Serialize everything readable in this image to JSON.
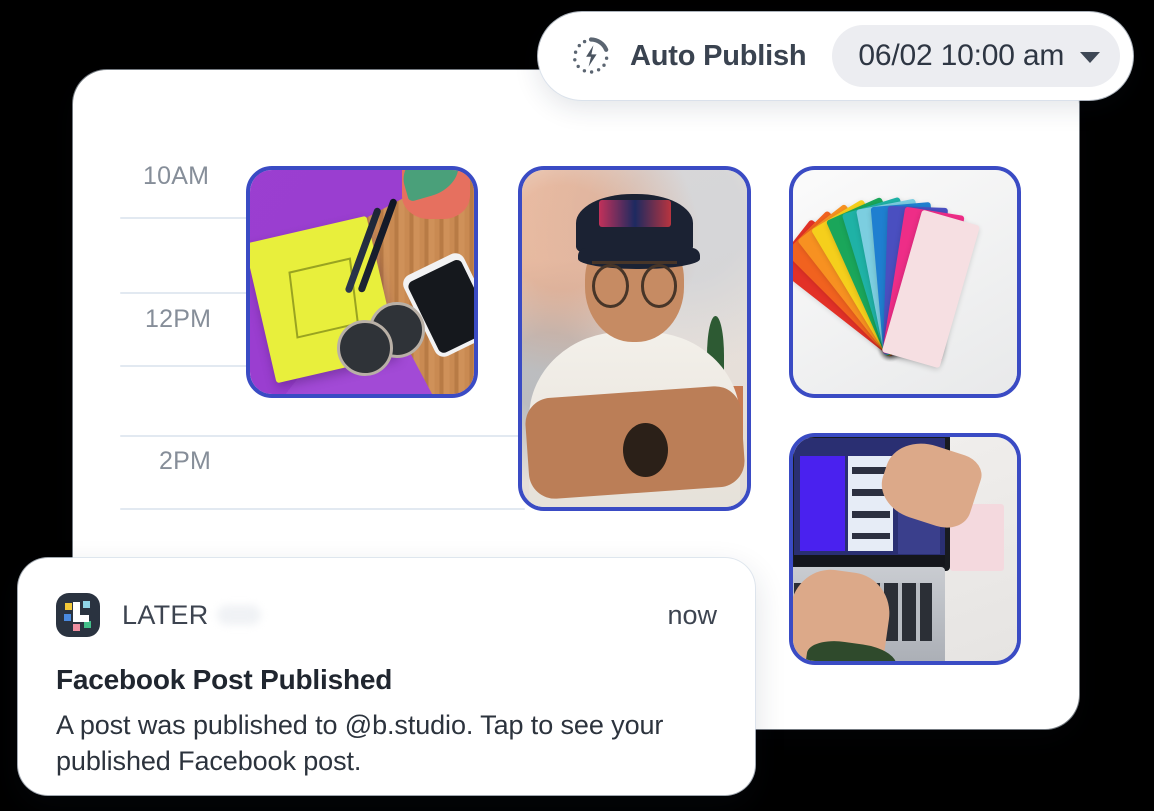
{
  "auto_publish": {
    "icon": "auto-publish-bolt-icon",
    "label": "Auto Publish",
    "date": "06/02",
    "time": "10:00 am",
    "date_time_combined": "06/02  10:00 am",
    "caret_icon": "chevron-down-icon"
  },
  "scheduler": {
    "time_labels": [
      "10AM",
      "12PM",
      "2PM"
    ],
    "gridline_count": 5,
    "posts": [
      {
        "slot": "10am-column-1",
        "alt": "Flat lay of a yellow notebook, pens, sunglasses and phone on a purple cloth over a wood desk",
        "border_color": "#3a4bc4"
      },
      {
        "slot": "10am-column-2",
        "alt": "Portrait of a smiling man wearing a black cap and glasses with arms crossed",
        "border_color": "#3a4bc4"
      },
      {
        "slot": "10am-column-3",
        "alt": "Fanned stack of rainbow coloured paper swatch cards on a white surface",
        "border_color": "#3a4bc4"
      },
      {
        "slot": "2pm-column-3",
        "alt": "Hands typing on a laptop running design software while another hand points at the screen",
        "border_color": "#3a4bc4"
      }
    ]
  },
  "notification": {
    "app_icon": "later-app-icon",
    "brand": "LATER",
    "timestamp": "now",
    "title": "Facebook Post Published",
    "body": "A post was published to @b.studio. Tap to see your published Facebook post."
  },
  "colors": {
    "card_background": "#ffffff",
    "page_background": "#000000",
    "thumbnail_border": "#3a4bc4",
    "gridline": "#e2e9f1",
    "time_label": "#868e99",
    "chip_background": "#ecedf1",
    "text_primary": "#20262f",
    "text_secondary": "#3d4450"
  },
  "swatch_fan": [
    {
      "color": "#e23127",
      "angle": -52
    },
    {
      "color": "#f1621f",
      "angle": -45
    },
    {
      "color": "#f79121",
      "angle": -38
    },
    {
      "color": "#f5cf1c",
      "angle": -31
    },
    {
      "color": "#1aa65a",
      "angle": -24
    },
    {
      "color": "#1fb2a6",
      "angle": -17
    },
    {
      "color": "#7ccee0",
      "angle": -11
    },
    {
      "color": "#1f7fd0",
      "angle": -5
    },
    {
      "color": "#4a4fc0",
      "angle": 2
    },
    {
      "color": "#ee2d87",
      "angle": 9
    },
    {
      "color": "#f6dfe2",
      "angle": 16
    }
  ]
}
